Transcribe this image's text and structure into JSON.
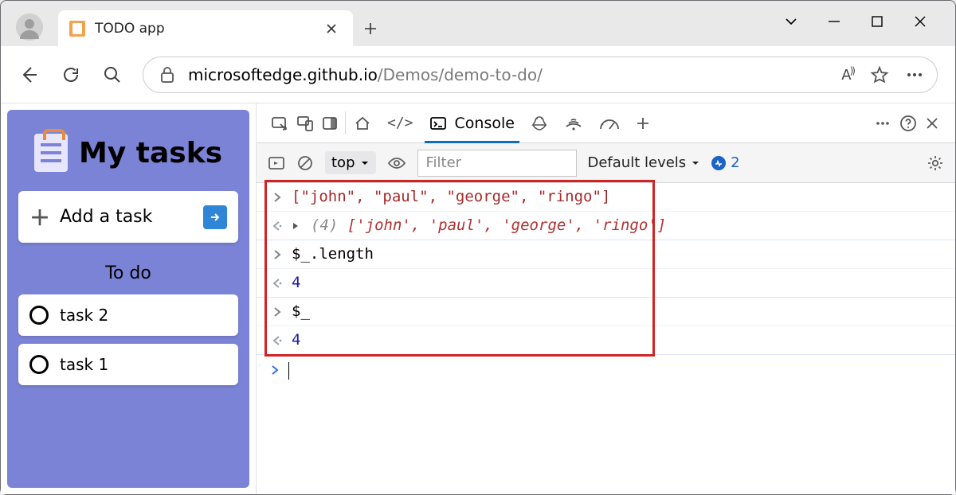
{
  "browser": {
    "tab_title": "TODO app",
    "url_dark": "microsoftedge.github.io",
    "url_rest": "/Demos/demo-to-do/"
  },
  "app": {
    "title": "My tasks",
    "add_label": "Add a task",
    "section": "To do",
    "tasks": [
      "task 2",
      "task 1"
    ]
  },
  "devtools": {
    "console_tab": "Console",
    "context": "top",
    "filter_placeholder": "Filter",
    "levels": "Default levels",
    "issues_count": "2",
    "lines": {
      "in1": "[\"john\", \"paul\", \"george\", \"ringo\"]",
      "out1_count": "(4)",
      "out1_arr": "['john', 'paul', 'george', 'ringo']",
      "in2": "$_.length",
      "out2": "4",
      "in3": "$_",
      "out3": "4"
    }
  }
}
